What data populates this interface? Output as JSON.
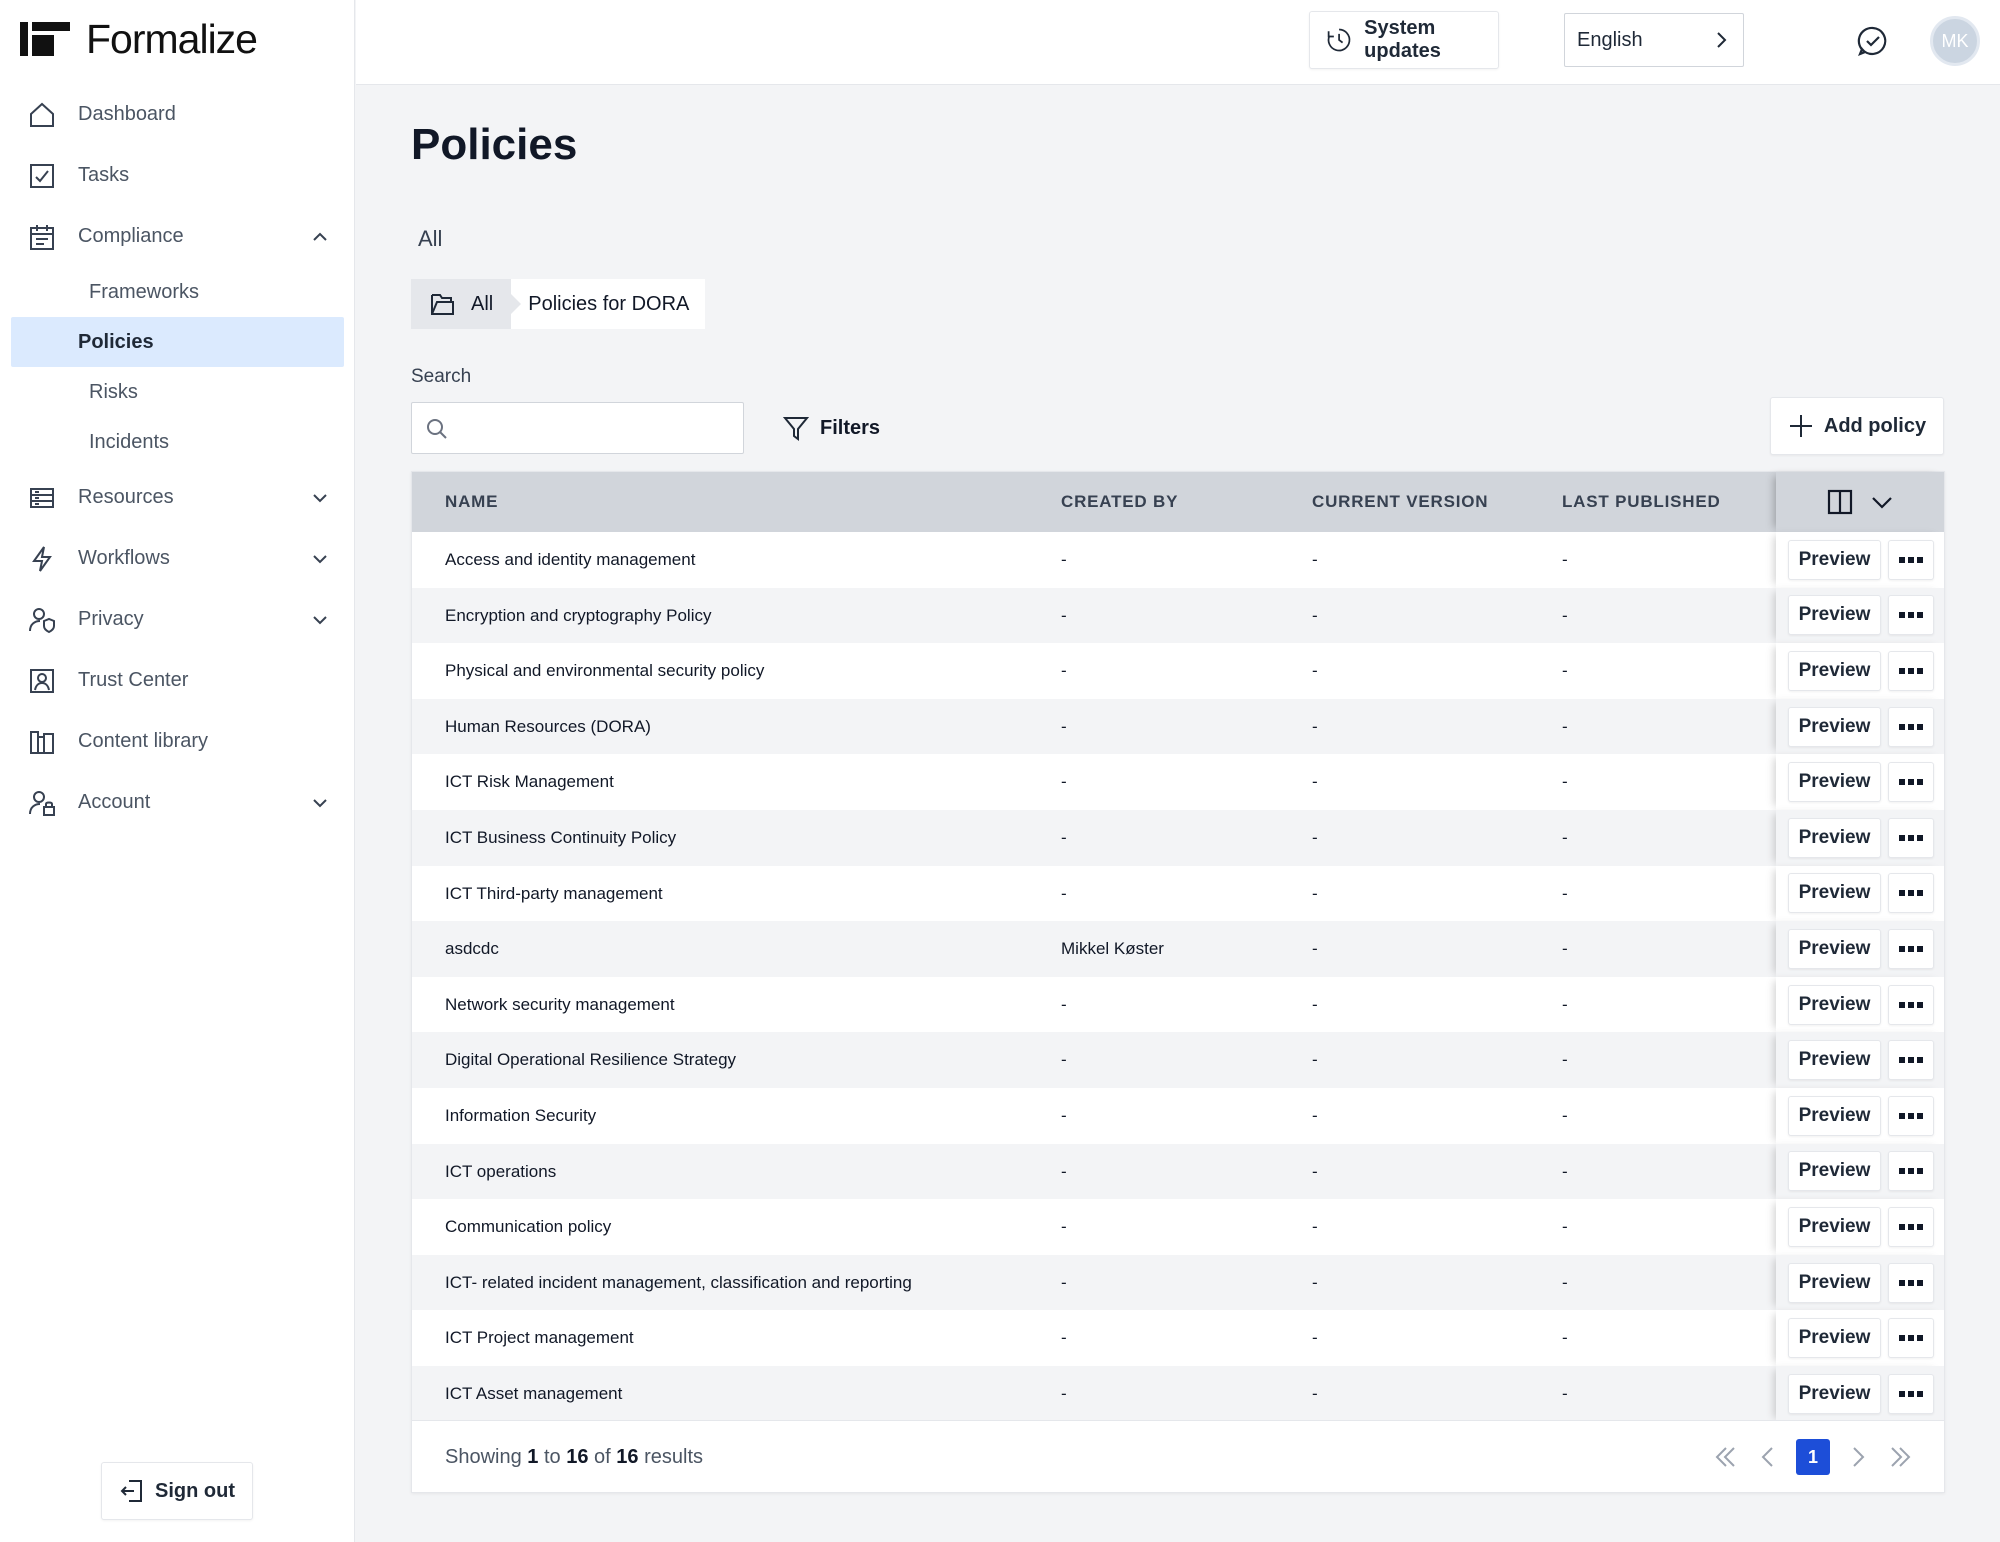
{
  "brand": {
    "name": "Formalize"
  },
  "topbar": {
    "updates_label": "System updates",
    "language": "English",
    "avatar_initials": "MK"
  },
  "sidebar": {
    "items": [
      {
        "label": "Dashboard",
        "icon": "home-icon"
      },
      {
        "label": "Tasks",
        "icon": "checkbox-icon"
      },
      {
        "label": "Compliance",
        "icon": "clipboard-icon",
        "expanded": true,
        "children": [
          {
            "label": "Frameworks"
          },
          {
            "label": "Policies",
            "active": true
          },
          {
            "label": "Risks"
          },
          {
            "label": "Incidents"
          }
        ]
      },
      {
        "label": "Resources",
        "icon": "server-icon"
      },
      {
        "label": "Workflows",
        "icon": "bolt-icon"
      },
      {
        "label": "Privacy",
        "icon": "user-shield-icon"
      },
      {
        "label": "Trust Center",
        "icon": "badge-icon"
      },
      {
        "label": "Content library",
        "icon": "library-icon"
      },
      {
        "label": "Account",
        "icon": "user-lock-icon"
      }
    ],
    "signout_label": "Sign out"
  },
  "main": {
    "title": "Policies",
    "scope_tab": "All",
    "breadcrumb": {
      "root": "All",
      "current": "Policies for DORA"
    },
    "search": {
      "label": "Search",
      "placeholder": ""
    },
    "filters_label": "Filters",
    "add_label": "Add policy"
  },
  "table": {
    "columns": [
      "NAME",
      "CREATED BY",
      "CURRENT VERSION",
      "LAST PUBLISHED"
    ],
    "preview_label": "Preview",
    "rows": [
      {
        "name": "Access and identity management",
        "created_by": "-",
        "version": "-",
        "published": "-"
      },
      {
        "name": "Encryption and cryptography Policy",
        "created_by": "-",
        "version": "-",
        "published": "-"
      },
      {
        "name": "Physical and environmental security policy",
        "created_by": "-",
        "version": "-",
        "published": "-"
      },
      {
        "name": "Human Resources (DORA)",
        "created_by": "-",
        "version": "-",
        "published": "-"
      },
      {
        "name": "ICT Risk Management",
        "created_by": "-",
        "version": "-",
        "published": "-"
      },
      {
        "name": "ICT Business Continuity Policy",
        "created_by": "-",
        "version": "-",
        "published": "-"
      },
      {
        "name": "ICT Third-party management",
        "created_by": "-",
        "version": "-",
        "published": "-"
      },
      {
        "name": "asdcdc",
        "created_by": "Mikkel Køster",
        "version": "-",
        "published": "-"
      },
      {
        "name": "Network security management",
        "created_by": "-",
        "version": "-",
        "published": "-"
      },
      {
        "name": "Digital Operational Resilience Strategy",
        "created_by": "-",
        "version": "-",
        "published": "-"
      },
      {
        "name": "Information Security",
        "created_by": "-",
        "version": "-",
        "published": "-"
      },
      {
        "name": "ICT operations",
        "created_by": "-",
        "version": "-",
        "published": "-"
      },
      {
        "name": "Communication policy",
        "created_by": "-",
        "version": "-",
        "published": "-"
      },
      {
        "name": "ICT- related incident management, classification and reporting",
        "created_by": "-",
        "version": "-",
        "published": "-"
      },
      {
        "name": "ICT Project management",
        "created_by": "-",
        "version": "-",
        "published": "-"
      },
      {
        "name": "ICT Asset management",
        "created_by": "-",
        "version": "-",
        "published": "-"
      }
    ],
    "footer": {
      "prefix": "Showing",
      "from": "1",
      "to_word": "to",
      "to": "16",
      "of_word": "of",
      "total": "16",
      "suffix": "results",
      "current_page": "1"
    }
  },
  "colors": {
    "accent": "#1d4ed8",
    "active_nav_bg": "#dbeafe",
    "header_bg": "#d1d5db"
  }
}
